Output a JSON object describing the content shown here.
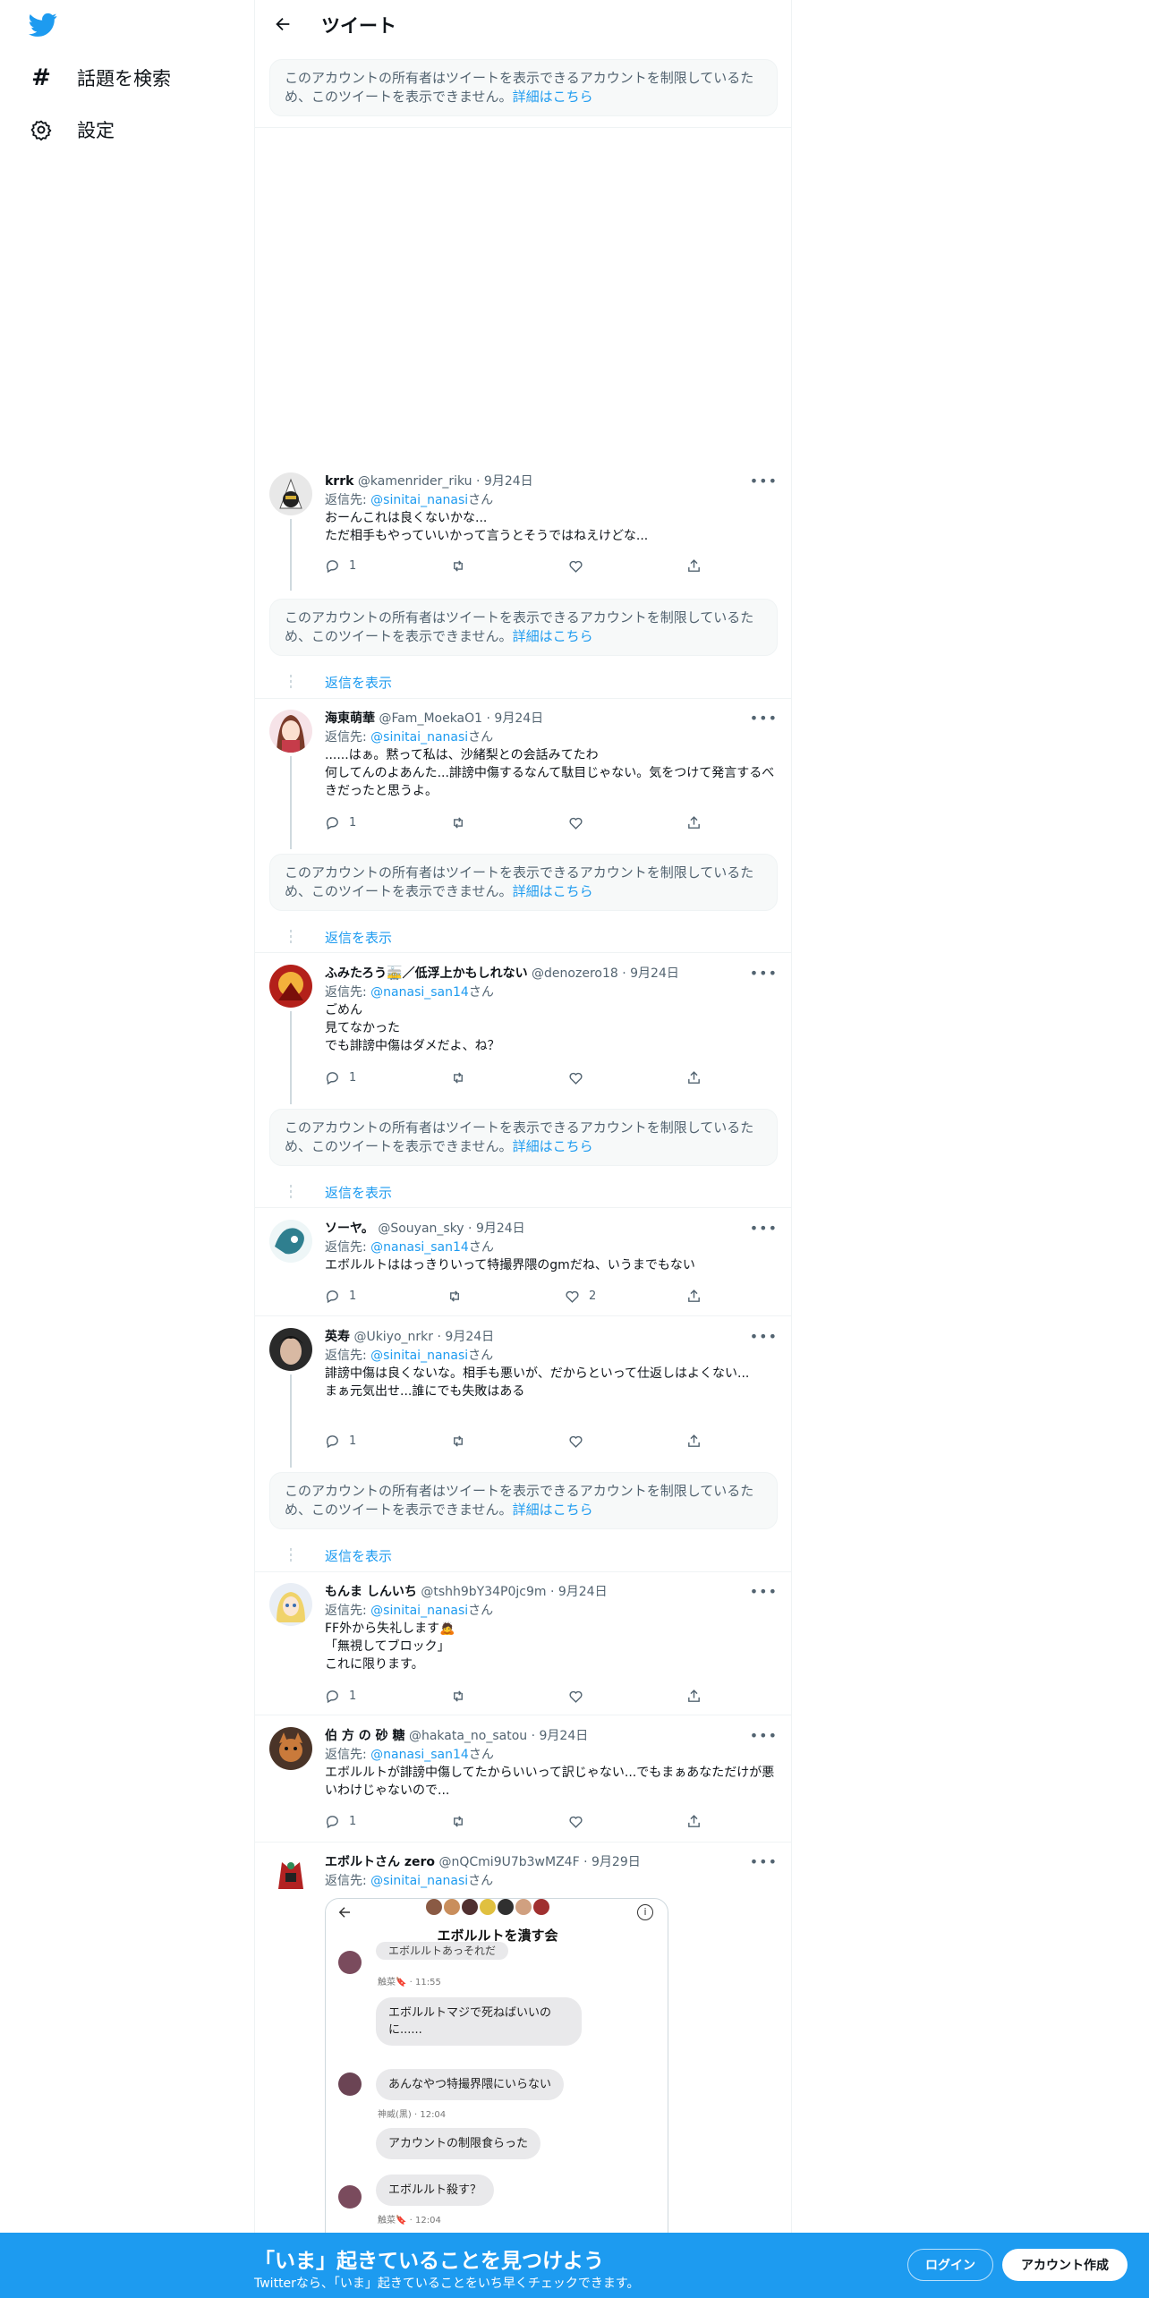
{
  "sidebar": {
    "explore_label": "話題を検索",
    "settings_label": "設定"
  },
  "header": {
    "title": "ツイート"
  },
  "restricted_notice": {
    "text": "このアカウントの所有者はツイートを表示できるアカウントを制限しているため、このツイートを表示できません。",
    "link": "詳細はこちら"
  },
  "show_replies_label": "返信を表示",
  "reply_to_prefix": "返信先: ",
  "reply_to_suffix": "さん",
  "tweets": [
    {
      "name": "krrk",
      "handle": "@kamenrider_riku",
      "date": "9月24日",
      "reply_to": "@sinitai_nanasi",
      "text": "おーんこれは良くないかな...\nただ相手もやっていいかって言うとそうではねえけどな...",
      "replies": "1",
      "likes": ""
    },
    {
      "name": "海東萌華",
      "handle": "@Fam_MoekaO1",
      "date": "9月24日",
      "reply_to": "@sinitai_nanasi",
      "text": "......はぁ。黙って私は、沙緒梨との会話みてたわ\n何してんのよあんた...誹謗中傷するなんて駄目じゃない。気をつけて発言するべきだったと思うよ。",
      "replies": "1",
      "likes": ""
    },
    {
      "name": "ふみたろう🚋／低浮上かもしれない",
      "handle": "@denozero18",
      "date": "9月24日",
      "reply_to": "@nanasi_san14",
      "text": "ごめん\n見てなかった\nでも誹謗中傷はダメだよ、ね？",
      "replies": "1",
      "likes": ""
    },
    {
      "name": "ソーヤ。",
      "handle": "@Souyan_sky",
      "date": "9月24日",
      "reply_to": "@nanasi_san14",
      "text": "エボルルトははっきりいって特撮界隈のgmだね、いうまでもない",
      "replies": "1",
      "likes": "2"
    },
    {
      "name": "英寿",
      "handle": "@Ukiyo_nrkr",
      "date": "9月24日",
      "reply_to": "@sinitai_nanasi",
      "text": "誹謗中傷は良くないな。相手も悪いが、だからといって仕返しはよくない...\nまぁ元気出せ...誰にでも失敗はある",
      "replies": "1",
      "likes": ""
    },
    {
      "name": "もんま しんいち",
      "handle": "@tshh9bY34P0jc9m",
      "date": "9月24日",
      "reply_to": "@sinitai_nanasi",
      "text": "FF外から失礼します🙇\n「無視してブロック」\nこれに限ります。",
      "replies": "1",
      "likes": ""
    },
    {
      "name": "伯 方 の 砂 糖",
      "handle": "@hakata_no_satou",
      "date": "9月24日",
      "reply_to": "@nanasi_san14",
      "text": "エボルルトが誹謗中傷してたからいいって訳じゃない...でもまぁあなただけが悪いわけじゃないので...",
      "replies": "1",
      "likes": ""
    },
    {
      "name": "エボルトさん zero",
      "handle": "@nQCmi9U7b3wMZ4F",
      "date": "9月29日",
      "reply_to": "@sinitai_nanasi",
      "text": "",
      "replies": "",
      "likes": ""
    }
  ],
  "screenshot": {
    "group_title": "エボルルトを潰す会",
    "top_cut": "エボルルトあっそれだ",
    "sender1": "触菜🔖 · 11:55",
    "msg1": "エボルルトマジで死ねばいいのに......",
    "msg2": "あんなやつ特撮界隈にいらない",
    "sender2": "神威(黒) · 12:04",
    "msg3": "アカウントの制限食らった",
    "msg4": "エボルルト殺す？",
    "sender3": "触菜🔖 · 12:04"
  },
  "bottom_bar": {
    "headline": "「いま」起きていることを見つけよう",
    "sub": "Twitterなら、「いま」起きていることをいち早くチェックできます。",
    "login": "ログイン",
    "signup": "アカウント作成"
  },
  "colors": {
    "accent": "#1d9bf0",
    "text": "#0f1419",
    "muted": "#536471"
  }
}
